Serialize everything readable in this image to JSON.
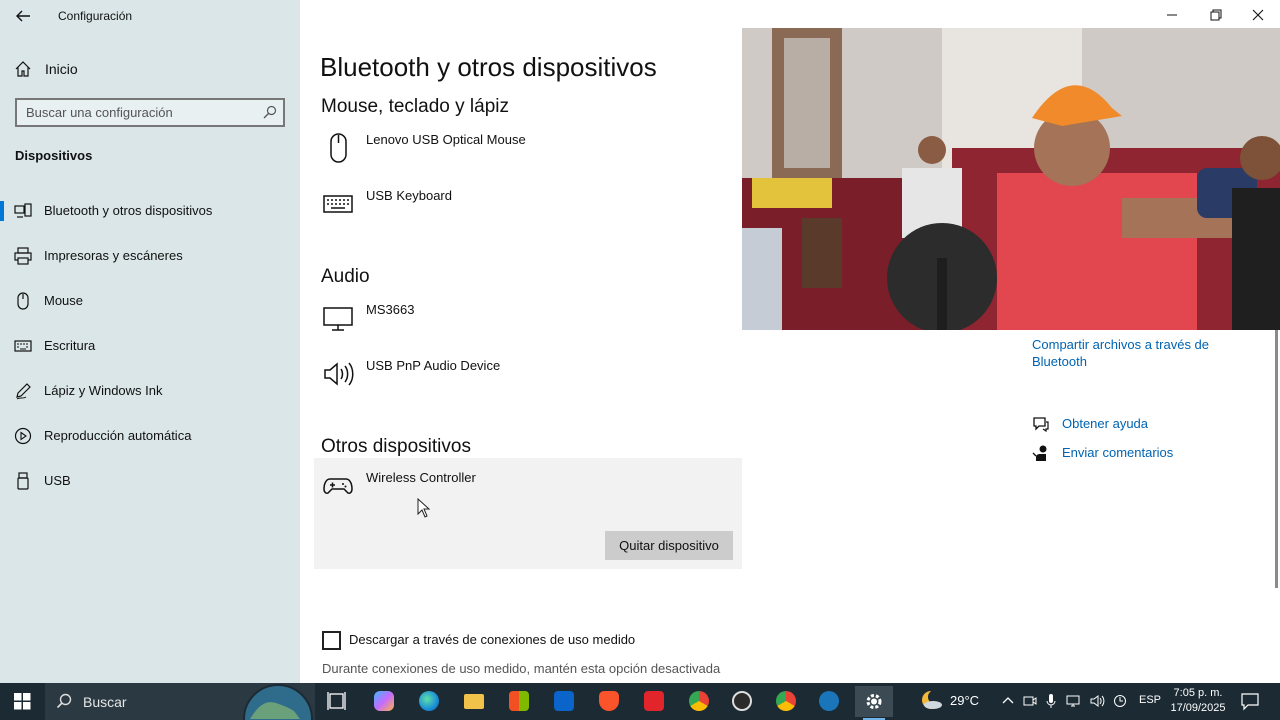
{
  "window": {
    "title": "Configuración",
    "controls": [
      "minimize",
      "restore",
      "close"
    ]
  },
  "sidebar": {
    "home_label": "Inicio",
    "search_placeholder": "Buscar una configuración",
    "section_title": "Dispositivos",
    "items": [
      {
        "label": "Bluetooth y otros dispositivos",
        "icon": "bluetooth-icon",
        "active": true
      },
      {
        "label": "Impresoras y escáneres",
        "icon": "printer-icon",
        "active": false
      },
      {
        "label": "Mouse",
        "icon": "mouse-icon",
        "active": false
      },
      {
        "label": "Escritura",
        "icon": "keyboard-icon",
        "active": false
      },
      {
        "label": "Lápiz y Windows Ink",
        "icon": "pen-icon",
        "active": false
      },
      {
        "label": "Reproducción automática",
        "icon": "autoplay-icon",
        "active": false
      },
      {
        "label": "USB",
        "icon": "usb-icon",
        "active": false
      }
    ]
  },
  "main": {
    "title": "Bluetooth y otros dispositivos",
    "sections": [
      {
        "heading": "Mouse, teclado y lápiz",
        "devices": [
          {
            "name": "Lenovo USB Optical Mouse",
            "icon": "mouse-icon"
          },
          {
            "name": "USB Keyboard",
            "icon": "keyboard-icon"
          }
        ]
      },
      {
        "heading": "Audio",
        "devices": [
          {
            "name": "MS3663",
            "icon": "monitor-icon"
          },
          {
            "name": "USB PnP Audio Device",
            "icon": "speaker-icon"
          }
        ]
      },
      {
        "heading": "Otros dispositivos",
        "devices": [
          {
            "name": "Wireless Controller",
            "icon": "gamepad-icon",
            "selected": true,
            "action_label": "Quitar dispositivo"
          }
        ]
      }
    ],
    "metered": {
      "checked": false,
      "label": "Descargar a través de conexiones de uso medido",
      "description": "Durante conexiones de uso medido, mantén esta opción desactivada"
    }
  },
  "related": {
    "share_link": "Compartir archivos a través de Bluetooth",
    "help_link": "Obtener ayuda",
    "feedback_link": "Enviar comentarios"
  },
  "taskbar": {
    "search_label": "Buscar",
    "apps": [
      "task-view",
      "copilot",
      "edge",
      "file-explorer",
      "store",
      "outlook",
      "brave",
      "wps",
      "chrome",
      "obs",
      "chrome",
      "steam",
      "settings"
    ],
    "weather": "29°C",
    "language": "ESP",
    "time": "7:05 p. m.",
    "date": "17/09/2025"
  },
  "colors": {
    "sidebar_bg": "#dbe6e9",
    "accent": "#0078d7",
    "link": "#0063b1",
    "taskbar_bg": "#1b2a33"
  }
}
